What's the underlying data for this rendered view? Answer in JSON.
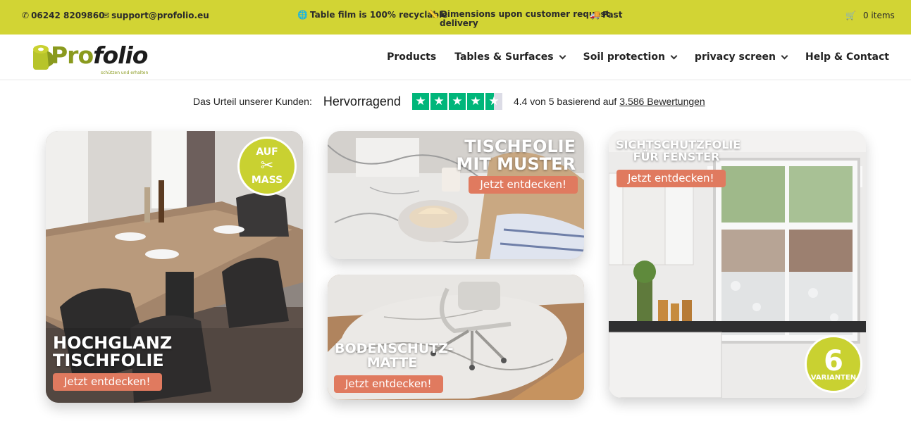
{
  "topbar": {
    "phone": "06242 8209860",
    "email": "support@profolio.eu",
    "usp_1": "Table film is 100% recyclable",
    "usp_2_line1": "Dimensions upon customer request",
    "usp_2_line2": "delivery",
    "usp_3": "Fast",
    "cart_count": "0 items"
  },
  "header": {
    "logo_pro": "Pro",
    "logo_folio": "folio",
    "logo_tagline": "schützen und erhalten",
    "nav": [
      {
        "label": "Products"
      },
      {
        "label": "Tables & Surfaces"
      },
      {
        "label": "Soil protection"
      },
      {
        "label": "privacy screen"
      },
      {
        "label": "Help & Contact"
      }
    ]
  },
  "trust": {
    "lead": "Das Urteil unserer Kunden:",
    "rating_word": "Hervorragend",
    "score_text": "4.4 von 5 basierend auf",
    "reviews_link": "3.586 Bewertungen",
    "stars": 4.4
  },
  "cards": {
    "highgloss": {
      "title_1": "HOCHGLANZ",
      "title_2": "TISCHFOLIE",
      "cta": "Jetzt entdecken!",
      "badge_1": "AUF",
      "badge_2": "MASS"
    },
    "pattern": {
      "title_1": "TISCHFOLIE",
      "title_2": "MIT MUSTER",
      "cta": "Jetzt entdecken!"
    },
    "floor": {
      "title_1": "BODENSCHUTZ-",
      "title_2": "MATTE",
      "cta": "Jetzt entdecken!"
    },
    "privacy": {
      "title_1": "SICHTSCHUTZFOLIE",
      "title_2": "FÜR FENSTER",
      "cta": "Jetzt entdecken!",
      "badge_num": "6",
      "badge_text": "VARIANTEN"
    }
  },
  "colors": {
    "topbar": "#d2d434",
    "cta": "#e07a5f",
    "trustpilot": "#00b67a",
    "badge": "#c9d131"
  }
}
